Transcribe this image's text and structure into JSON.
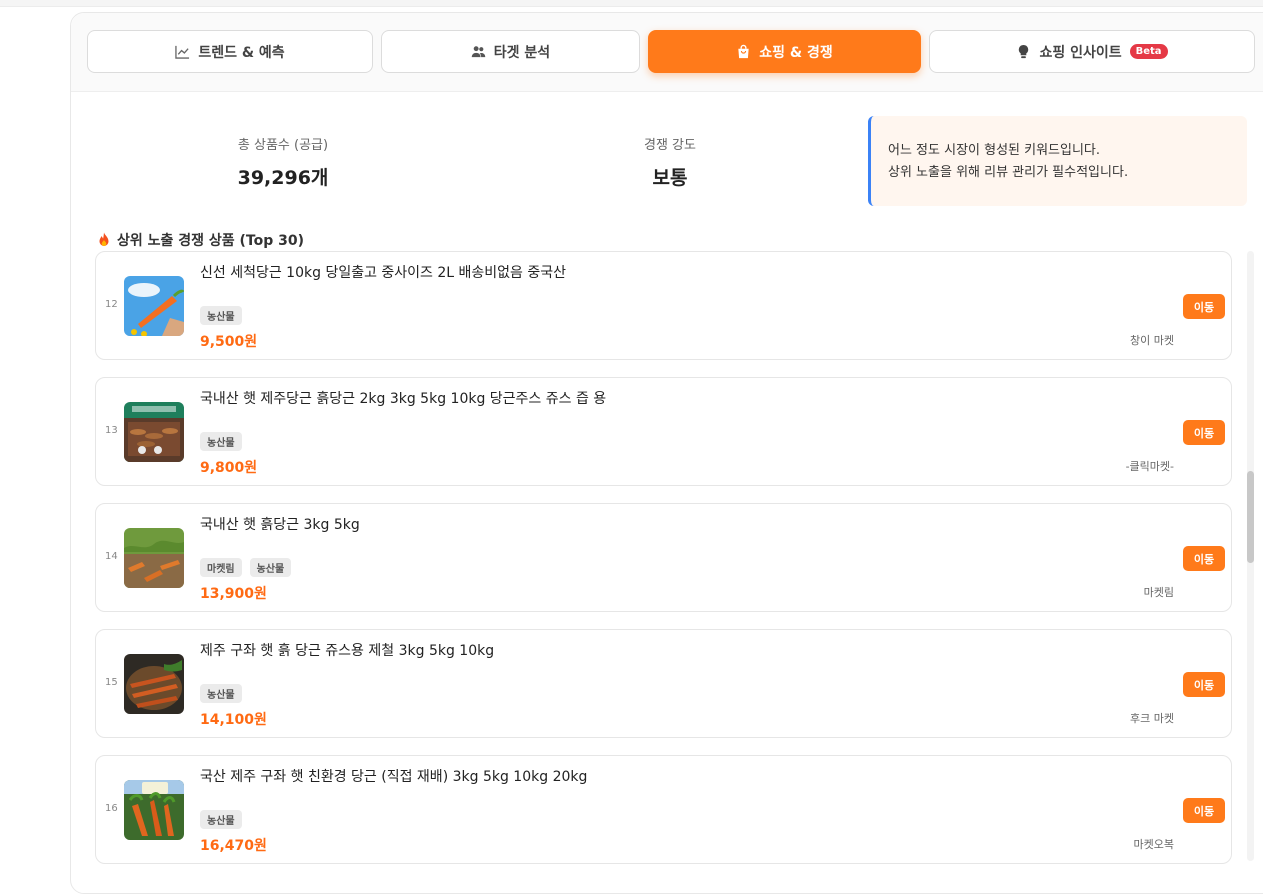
{
  "tabs": [
    {
      "label": "트렌드 & 예측",
      "icon": "trend-chart-icon"
    },
    {
      "label": "타겟 분석",
      "icon": "users-icon"
    },
    {
      "label": "쇼핑 & 경쟁",
      "icon": "shopping-bag-icon",
      "active": true
    },
    {
      "label": "쇼핑 인사이트",
      "icon": "lightbulb-icon",
      "badge": "Beta"
    }
  ],
  "stats": {
    "total_products_label": "총 상품수 (공급)",
    "total_products_value": "39,296개",
    "competition_label": "경쟁 강도",
    "competition_value": "보통"
  },
  "notice": {
    "line1": "어느 정도 시장이 형성된 키워드입니다.",
    "line2": "상위 노출을 위해 리뷰 관리가 필수적입니다."
  },
  "section_title": "상위 노출 경쟁 상품 (Top 30)",
  "go_label": "이동",
  "products": [
    {
      "rank": "12",
      "title": "신선 세척당근 10kg 당일출고 중사이즈 2L 배송비없음 중국산",
      "tags": [
        "농산물"
      ],
      "price": "9,500원",
      "seller": "창이 마켓",
      "thumb": "carrot-sky-photo-icon"
    },
    {
      "rank": "13",
      "title": "국내산 햇 제주당근 흙당근 2kg 3kg 5kg 10kg 당근주스 쥬스 즙 용",
      "tags": [
        "농산물"
      ],
      "price": "9,800원",
      "seller": "-클릭마켓-",
      "thumb": "carrot-box-photo-icon"
    },
    {
      "rank": "14",
      "title": "국내산 햇 흙당근 3kg 5kg",
      "tags": [
        "마켓림",
        "농산물"
      ],
      "price": "13,900원",
      "seller": "마켓림",
      "thumb": "carrot-field-photo-icon"
    },
    {
      "rank": "15",
      "title": "제주 구좌 햇 흙 당근 쥬스용 제철 3kg 5kg 10kg",
      "tags": [
        "농산물"
      ],
      "price": "14,100원",
      "seller": "후크 마켓",
      "thumb": "carrot-basket-photo-icon"
    },
    {
      "rank": "16",
      "title": "국산 제주 구좌 햇 친환경 당근 (직접 재배) 3kg 5kg 10kg 20kg",
      "tags": [
        "농산물"
      ],
      "price": "16,470원",
      "seller": "마켓오복",
      "thumb": "carrot-farm-photo-icon"
    }
  ]
}
